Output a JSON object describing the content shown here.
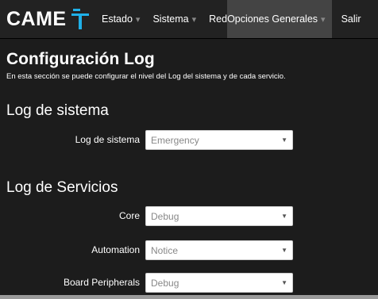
{
  "brand": {
    "name": "CAME"
  },
  "nav": {
    "items": [
      {
        "label": "Estado",
        "dropdown": true
      },
      {
        "label": "Sistema",
        "dropdown": true
      },
      {
        "label": "Red",
        "dropdown": false
      },
      {
        "label": "Opciones Generales",
        "dropdown": true,
        "active": true
      },
      {
        "label": "Salir",
        "dropdown": false
      }
    ],
    "caret": "▾"
  },
  "page": {
    "title": "Configuración Log",
    "description": "En esta sección se puede configurar el nivel del Log del sistema y de cada servicio."
  },
  "system_log": {
    "heading": "Log de sistema",
    "label": "Log de sistema",
    "value": "Emergency"
  },
  "services_log": {
    "heading": "Log de Servicios",
    "rows": [
      {
        "label": "Core",
        "value": "Debug"
      },
      {
        "label": "Automation",
        "value": "Notice"
      },
      {
        "label": "Board Peripherals",
        "value": "Debug"
      }
    ]
  },
  "colors": {
    "logo_accent": "#1fb0e8",
    "topbar": "#222222",
    "background": "#1c1c1c"
  }
}
